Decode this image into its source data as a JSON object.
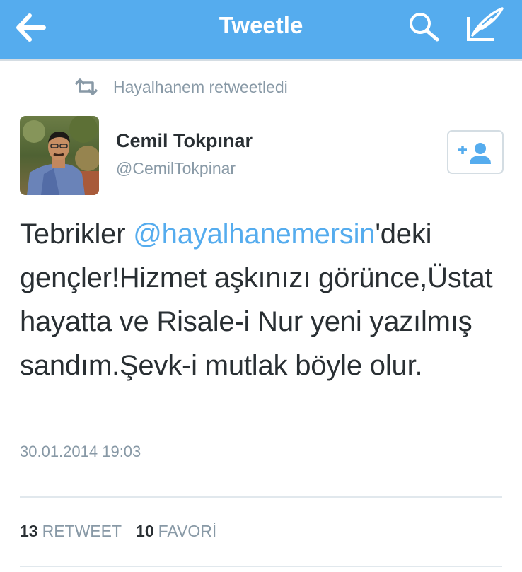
{
  "header": {
    "title": "Tweetle",
    "bar_color": "#55acee"
  },
  "context": {
    "retweet_text": "Hayalhanem retweetledi",
    "icon": "retweet-icon"
  },
  "author": {
    "name": "Cemil Tokpınar",
    "handle": "@CemilTokpinar",
    "follow_icon": "add-user-icon"
  },
  "tweet": {
    "text_before": "Tebrikler ",
    "mention": "@hayalhanemersin",
    "text_after": "'deki gençler!Hizmet aşkınızı görünce,Üstat hayatta ve Risale-i Nur yeni yazılmış sandım.Şevk-i mutlak böyle olur.",
    "timestamp": "30.01.2014 19:03",
    "mention_color": "#55acee"
  },
  "stats": {
    "retweet_count": "13",
    "retweet_label": "RETWEET",
    "favorite_count": "10",
    "favorite_label": "FAVORİ"
  }
}
